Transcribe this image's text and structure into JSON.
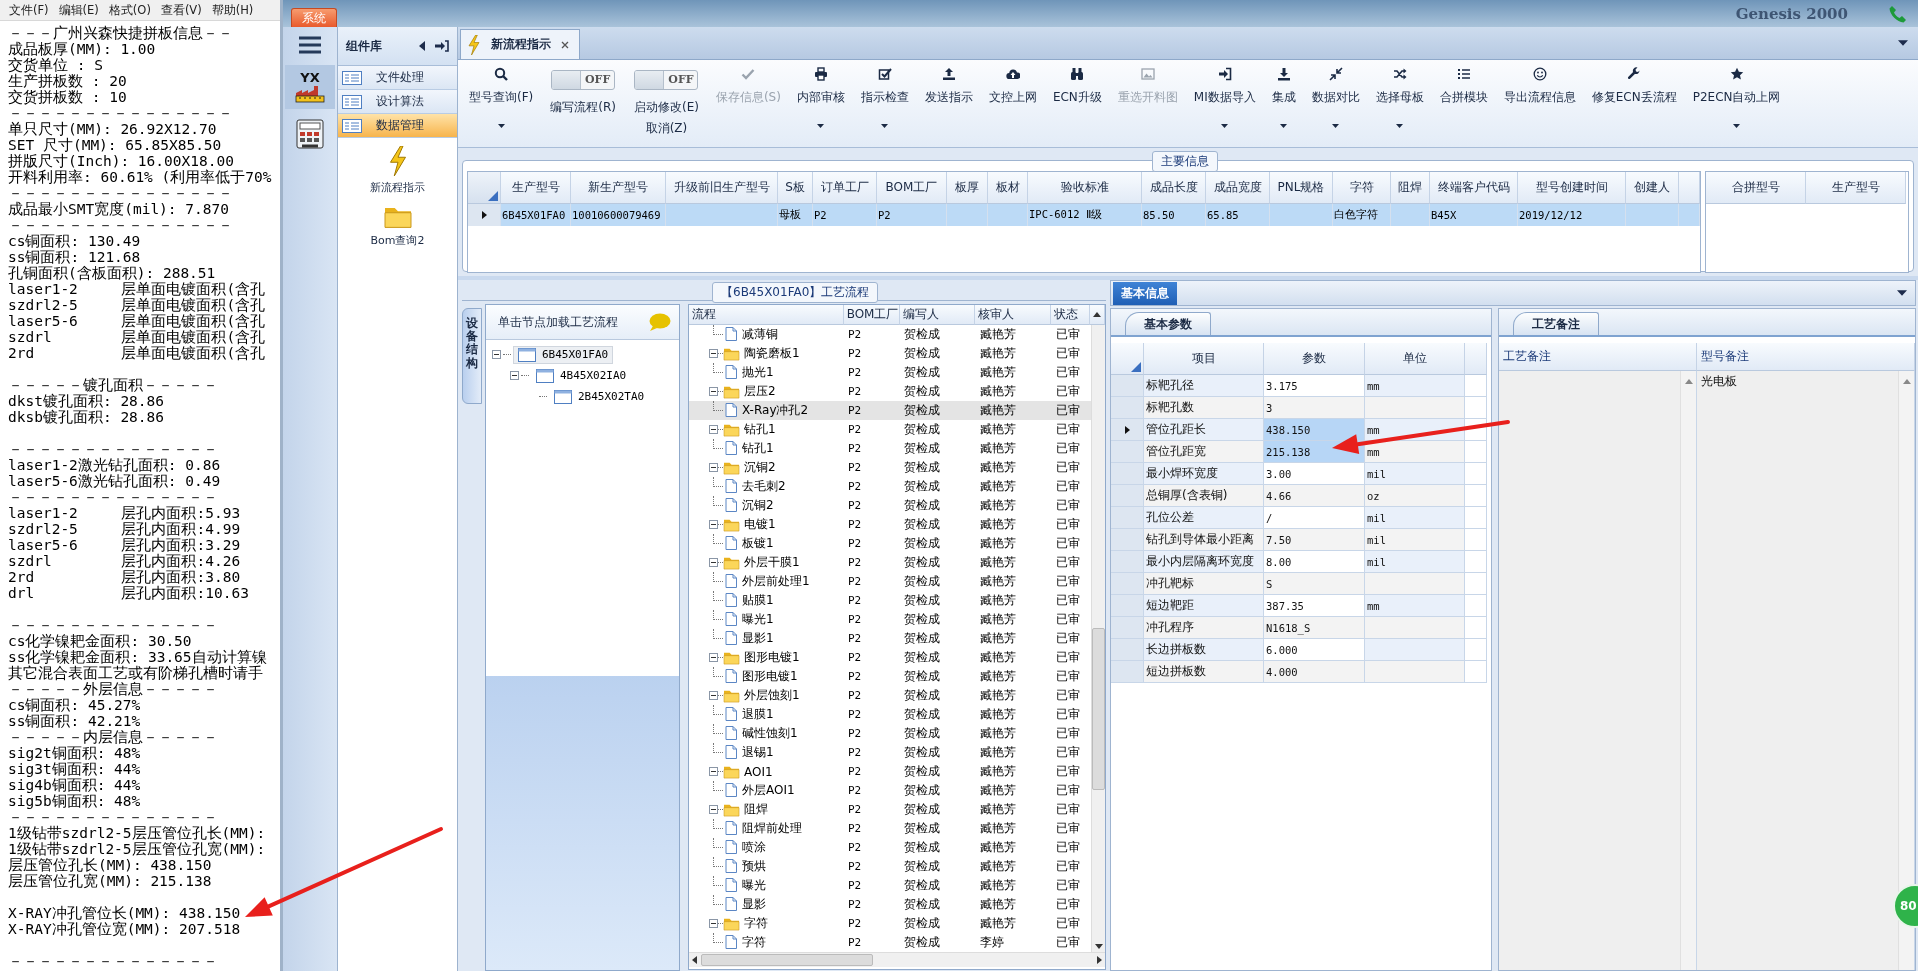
{
  "notepad": {
    "menu": [
      "文件(F)",
      "编辑(E)",
      "格式(O)",
      "查看(V)",
      "帮助(H)"
    ],
    "blocks": [
      [
        "－－－广州兴森快捷拼板信息－－",
        "成品板厚(MM): 1.00",
        "交货单位 : S",
        "生产拼板数 : 20",
        "交货拼板数 : 10",
        "－－－－－－－－－－－－－－－",
        "单只尺寸(MM): 26.92X12.70",
        "SET 尺寸(MM): 65.85X85.50",
        "拼版尺寸(Inch): 16.00X18.00",
        "开料利用率: 60.61% (利用率低于70%",
        "－－－－－－－－－－－－－－－",
        "成品最小SMT宽度(mil): 7.870",
        "－－－－－－－－－－－－－－－",
        "cs铜面积: 130.49",
        "ss铜面积: 121.68",
        "孔铜面积(含板面积): 288.51",
        "laser1-2     层单面电镀面积(含孔",
        "szdrl2-5     层单面电镀面积(含孔",
        "laser5-6     层单面电镀面积(含孔",
        "szdrl        层单面电镀面积(含孔",
        "2rd          层单面电镀面积(含孔"
      ],
      [
        "－－－－－镀孔面积－－－－－",
        "dkst镀孔面积: 28.86",
        "dksb镀孔面积: 28.86"
      ],
      [
        "－－－－－－－－－－－－－－",
        "laser1-2激光钻孔面积: 0.86",
        "laser5-6激光钻孔面积: 0.49",
        "－－－－－－－－－－－－－－",
        "laser1-2     层孔内面积:5.93",
        "szdrl2-5     层孔内面积:4.99",
        "laser5-6     层孔内面积:3.29",
        "szdrl        层孔内面积:4.26",
        "2rd          层孔内面积:3.80",
        "drl          层孔内面积:10.63"
      ],
      [
        "－－－－－－－－－－－－－－",
        "cs化学镍耙金面积: 30.50",
        "ss化学镍耙金面积: 33.65自动计算镍",
        "其它混合表面工艺或有阶梯孔槽时请手",
        "－－－－－外层信息－－－－－",
        "cs铜面积: 45.27%",
        "ss铜面积: 42.21%",
        "－－－－－内层信息－－－－－",
        "sig2t铜面积: 48%",
        "sig3t铜面积: 44%",
        "sig4b铜面积: 44%",
        "sig5b铜面积: 48%",
        "－－－－－－－－－－－－－－",
        "1级钻带szdrl2-5层压管位孔长(MM):",
        "1级钻带szdrl2-5层压管位孔宽(MM):",
        "层压管位孔长(MM): 438.150",
        "层压管位孔宽(MM): 215.138"
      ],
      [
        "X-RAY冲孔管位长(MM): 438.150",
        "X-RAY冲孔管位宽(MM): 207.518"
      ],
      [
        "－－－－－－－－－－－－－－"
      ]
    ]
  },
  "topbar": {
    "system_button": "系统",
    "background_text": "Genesis 2000"
  },
  "rail": {
    "logo_text": "YX"
  },
  "library": {
    "title": "组件库",
    "categories": [
      {
        "label": "文件处理",
        "selected": false
      },
      {
        "label": "设计算法",
        "selected": false
      },
      {
        "label": "数据管理",
        "selected": true
      }
    ],
    "tools": [
      {
        "label": "新流程指示",
        "kind": "lightning"
      },
      {
        "label": "Bom查询2",
        "kind": "folder"
      }
    ]
  },
  "tabs": [
    {
      "label": "新流程指示",
      "selected": true
    }
  ],
  "toolbar": [
    {
      "kind": "button",
      "label": "型号查询(F)",
      "dropdown": true,
      "disabled": false
    },
    {
      "kind": "toggle",
      "label": "编写流程(R)",
      "state_text": "OFF",
      "on": false
    },
    {
      "kind": "toggle",
      "label": "启动修改(E)",
      "sublabel": "取消(Z)",
      "state_text": "OFF",
      "on": false
    },
    {
      "kind": "button",
      "label": "保存信息(S)",
      "dropdown": false,
      "disabled": true
    },
    {
      "kind": "button",
      "label": "内部审核",
      "dropdown": true,
      "disabled": false
    },
    {
      "kind": "button",
      "label": "指示检查",
      "dropdown": true,
      "disabled": false
    },
    {
      "kind": "button",
      "label": "发送指示",
      "dropdown": false,
      "disabled": false
    },
    {
      "kind": "button",
      "label": "文控上网",
      "dropdown": false,
      "disabled": false
    },
    {
      "kind": "button",
      "label": "ECN升级",
      "dropdown": false,
      "disabled": false
    },
    {
      "kind": "button",
      "label": "重选开料图",
      "dropdown": false,
      "disabled": true
    },
    {
      "kind": "button",
      "label": "MI数据导入",
      "dropdown": true,
      "disabled": false
    },
    {
      "kind": "button",
      "label": "集成",
      "dropdown": true,
      "disabled": false
    },
    {
      "kind": "button",
      "label": "数据对比",
      "dropdown": true,
      "disabled": false
    },
    {
      "kind": "button",
      "label": "选择母板",
      "dropdown": true,
      "disabled": false
    },
    {
      "kind": "button",
      "label": "合拼模块",
      "dropdown": false,
      "disabled": false
    },
    {
      "kind": "button",
      "label": "导出流程信息",
      "dropdown": false,
      "disabled": false
    },
    {
      "kind": "button",
      "label": "修复ECN丢流程",
      "dropdown": false,
      "disabled": false
    },
    {
      "kind": "button",
      "label": "P2ECN自动上网",
      "dropdown": true,
      "disabled": false
    }
  ],
  "main_info": {
    "title": "主要信息",
    "columns": [
      "生产型号",
      "新生产型号",
      "升级前旧生产型号",
      "S板",
      "订单工厂",
      "BOM工厂",
      "板厚",
      "板材",
      "验收标准",
      "成品长度",
      "成品宽度",
      "PNL规格",
      "字符",
      "阻焊",
      "终端客户代码",
      "型号创建时间",
      "创建人"
    ],
    "rows": [
      {
        "selected": true,
        "cells": [
          "6B45X01FA0",
          "10010600079469",
          null,
          "母板",
          "P2",
          "P2",
          null,
          null,
          "IPC-6012 Ⅱ级",
          "85.50",
          "65.85",
          null,
          "白色字符",
          null,
          "B45X",
          "2019/12/12",
          null
        ]
      }
    ],
    "merge_columns": [
      "合拼型号",
      "生产型号"
    ]
  },
  "flow": {
    "title": "【6B45X01FA0】工艺流程",
    "side_tab": "设备结构",
    "tree_hint": "单击节点加载工艺流程",
    "tree": [
      {
        "label": "6B45X01FA0",
        "selected": true,
        "expanded": true,
        "children": [
          {
            "label": "4B45X02IA0",
            "selected": false,
            "expanded": true,
            "children": [
              {
                "label": "2B45X02TA0",
                "selected": false
              }
            ]
          }
        ]
      }
    ],
    "columns": [
      "流程",
      "BOM工厂",
      "编写人",
      "核审人",
      "状态"
    ],
    "rows": [
      {
        "kind": "file",
        "name": "减薄铜",
        "factory": "P2",
        "writer": "贺检成",
        "reviewer": "臧艳芳",
        "status": "已审",
        "selected": false
      },
      {
        "kind": "folder",
        "name": "陶瓷磨板1",
        "factory": "P2",
        "writer": "贺检成",
        "reviewer": "臧艳芳",
        "status": "已审",
        "selected": false,
        "expanded": true,
        "children": [
          {
            "kind": "file",
            "name": "抛光1",
            "factory": "P2",
            "writer": "贺检成",
            "reviewer": "臧艳芳",
            "status": "已审",
            "selected": false
          }
        ]
      },
      {
        "kind": "folder",
        "name": "层压2",
        "factory": "P2",
        "writer": "贺检成",
        "reviewer": "臧艳芳",
        "status": "已审",
        "selected": false,
        "expanded": true,
        "children": [
          {
            "kind": "file",
            "name": "X-Ray冲孔2",
            "factory": "P2",
            "writer": "贺检成",
            "reviewer": "臧艳芳",
            "status": "已审",
            "selected": true
          }
        ]
      },
      {
        "kind": "folder",
        "name": "钻孔1",
        "factory": "P2",
        "writer": "贺检成",
        "reviewer": "臧艳芳",
        "status": "已审",
        "selected": false,
        "expanded": true,
        "children": [
          {
            "kind": "file",
            "name": "钻孔1",
            "factory": "P2",
            "writer": "贺检成",
            "reviewer": "臧艳芳",
            "status": "已审",
            "selected": false
          }
        ]
      },
      {
        "kind": "folder",
        "name": "沉铜2",
        "factory": "P2",
        "writer": "贺检成",
        "reviewer": "臧艳芳",
        "status": "已审",
        "selected": false,
        "expanded": true,
        "children": [
          {
            "kind": "file",
            "name": "去毛刺2",
            "factory": "P2",
            "writer": "贺检成",
            "reviewer": "臧艳芳",
            "status": "已审",
            "selected": false
          },
          {
            "kind": "file",
            "name": "沉铜2",
            "factory": "P2",
            "writer": "贺检成",
            "reviewer": "臧艳芳",
            "status": "已审",
            "selected": false
          }
        ]
      },
      {
        "kind": "folder",
        "name": "电镀1",
        "factory": "P2",
        "writer": "贺检成",
        "reviewer": "臧艳芳",
        "status": "已审",
        "selected": false,
        "expanded": true,
        "children": [
          {
            "kind": "file",
            "name": "板镀1",
            "factory": "P2",
            "writer": "贺检成",
            "reviewer": "臧艳芳",
            "status": "已审",
            "selected": false
          }
        ]
      },
      {
        "kind": "folder",
        "name": "外层干膜1",
        "factory": "P2",
        "writer": "贺检成",
        "reviewer": "臧艳芳",
        "status": "已审",
        "selected": false,
        "expanded": true,
        "children": [
          {
            "kind": "file",
            "name": "外层前处理1",
            "factory": "P2",
            "writer": "贺检成",
            "reviewer": "臧艳芳",
            "status": "已审",
            "selected": false
          },
          {
            "kind": "file",
            "name": "贴膜1",
            "factory": "P2",
            "writer": "贺检成",
            "reviewer": "臧艳芳",
            "status": "已审",
            "selected": false
          },
          {
            "kind": "file",
            "name": "曝光1",
            "factory": "P2",
            "writer": "贺检成",
            "reviewer": "臧艳芳",
            "status": "已审",
            "selected": false
          },
          {
            "kind": "file",
            "name": "显影1",
            "factory": "P2",
            "writer": "贺检成",
            "reviewer": "臧艳芳",
            "status": "已审",
            "selected": false
          }
        ]
      },
      {
        "kind": "folder",
        "name": "图形电镀1",
        "factory": "P2",
        "writer": "贺检成",
        "reviewer": "臧艳芳",
        "status": "已审",
        "selected": false,
        "expanded": true,
        "children": [
          {
            "kind": "file",
            "name": "图形电镀1",
            "factory": "P2",
            "writer": "贺检成",
            "reviewer": "臧艳芳",
            "status": "已审",
            "selected": false
          }
        ]
      },
      {
        "kind": "folder",
        "name": "外层蚀刻1",
        "factory": "P2",
        "writer": "贺检成",
        "reviewer": "臧艳芳",
        "status": "已审",
        "selected": false,
        "expanded": true,
        "children": [
          {
            "kind": "file",
            "name": "退膜1",
            "factory": "P2",
            "writer": "贺检成",
            "reviewer": "臧艳芳",
            "status": "已审",
            "selected": false
          },
          {
            "kind": "file",
            "name": "碱性蚀刻1",
            "factory": "P2",
            "writer": "贺检成",
            "reviewer": "臧艳芳",
            "status": "已审",
            "selected": false
          },
          {
            "kind": "file",
            "name": "退锡1",
            "factory": "P2",
            "writer": "贺检成",
            "reviewer": "臧艳芳",
            "status": "已审",
            "selected": false
          }
        ]
      },
      {
        "kind": "folder",
        "name": "AOI1",
        "factory": "P2",
        "writer": "贺检成",
        "reviewer": "臧艳芳",
        "status": "已审",
        "selected": false,
        "expanded": true,
        "children": [
          {
            "kind": "file",
            "name": "外层AOI1",
            "factory": "P2",
            "writer": "贺检成",
            "reviewer": "臧艳芳",
            "status": "已审",
            "selected": false
          }
        ]
      },
      {
        "kind": "folder",
        "name": "阻焊",
        "factory": "P2",
        "writer": "贺检成",
        "reviewer": "臧艳芳",
        "status": "已审",
        "selected": false,
        "expanded": true,
        "children": [
          {
            "kind": "file",
            "name": "阻焊前处理",
            "factory": "P2",
            "writer": "贺检成",
            "reviewer": "臧艳芳",
            "status": "已审",
            "selected": false
          },
          {
            "kind": "file",
            "name": "喷涂",
            "factory": "P2",
            "writer": "贺检成",
            "reviewer": "臧艳芳",
            "status": "已审",
            "selected": false
          },
          {
            "kind": "file",
            "name": "预烘",
            "factory": "P2",
            "writer": "贺检成",
            "reviewer": "臧艳芳",
            "status": "已审",
            "selected": false
          },
          {
            "kind": "file",
            "name": "曝光",
            "factory": "P2",
            "writer": "贺检成",
            "reviewer": "臧艳芳",
            "status": "已审",
            "selected": false
          },
          {
            "kind": "file",
            "name": "显影",
            "factory": "P2",
            "writer": "贺检成",
            "reviewer": "臧艳芳",
            "status": "已审",
            "selected": false
          }
        ]
      },
      {
        "kind": "folder",
        "name": "字符",
        "factory": "P2",
        "writer": "贺检成",
        "reviewer": "臧艳芳",
        "status": "已审",
        "selected": false,
        "expanded": true,
        "children": [
          {
            "kind": "file",
            "name": "字符",
            "factory": "P2",
            "writer": "贺检成",
            "reviewer": "李婷",
            "status": "已审",
            "selected": false
          }
        ]
      }
    ]
  },
  "info": {
    "tabs": [
      {
        "label": "基本信息",
        "selected": true
      }
    ],
    "params": {
      "tabs": [
        {
          "label": "基本参数",
          "selected": true
        }
      ],
      "columns": [
        "项目",
        "参数",
        "单位"
      ],
      "rows": [
        {
          "item": "标靶孔径",
          "value": "3.175",
          "unit": "mm",
          "selected": false,
          "current": false
        },
        {
          "item": "标靶孔数",
          "value": "3",
          "unit": null,
          "selected": false,
          "current": false
        },
        {
          "item": "管位孔距长",
          "value": "438.150",
          "unit": "mm",
          "selected": true,
          "current": true
        },
        {
          "item": "管位孔距宽",
          "value": "215.138",
          "unit": "mm",
          "selected": true,
          "current": false
        },
        {
          "item": "最小焊环宽度",
          "value": "3.00",
          "unit": "mil",
          "selected": false,
          "current": false
        },
        {
          "item": "总铜厚(含表铜)",
          "value": "4.66",
          "unit": "oz",
          "selected": false,
          "current": false
        },
        {
          "item": "孔位公差",
          "value": "/",
          "unit": "mil",
          "selected": false,
          "current": false
        },
        {
          "item": "钻孔到导体最小距离",
          "value": "7.50",
          "unit": "mil",
          "selected": false,
          "current": false
        },
        {
          "item": "最小内层隔离环宽度",
          "value": "8.00",
          "unit": "mil",
          "selected": false,
          "current": false
        },
        {
          "item": "冲孔靶标",
          "value": "S",
          "unit": null,
          "selected": false,
          "current": false
        },
        {
          "item": "短边靶距",
          "value": "387.35",
          "unit": "mm",
          "selected": false,
          "current": false
        },
        {
          "item": "冲孔程序",
          "value": "N1618_S",
          "unit": null,
          "selected": false,
          "current": false
        },
        {
          "item": "长边拼板数",
          "value": "6.000",
          "unit": null,
          "selected": false,
          "current": false
        },
        {
          "item": "短边拼板数",
          "value": "4.000",
          "unit": null,
          "selected": false,
          "current": false
        }
      ]
    },
    "notes": {
      "tabs": [
        {
          "label": "工艺备注",
          "selected": true
        }
      ],
      "columns": [
        "工艺备注",
        "型号备注"
      ],
      "model_note": "光电板"
    }
  },
  "badge": "80"
}
